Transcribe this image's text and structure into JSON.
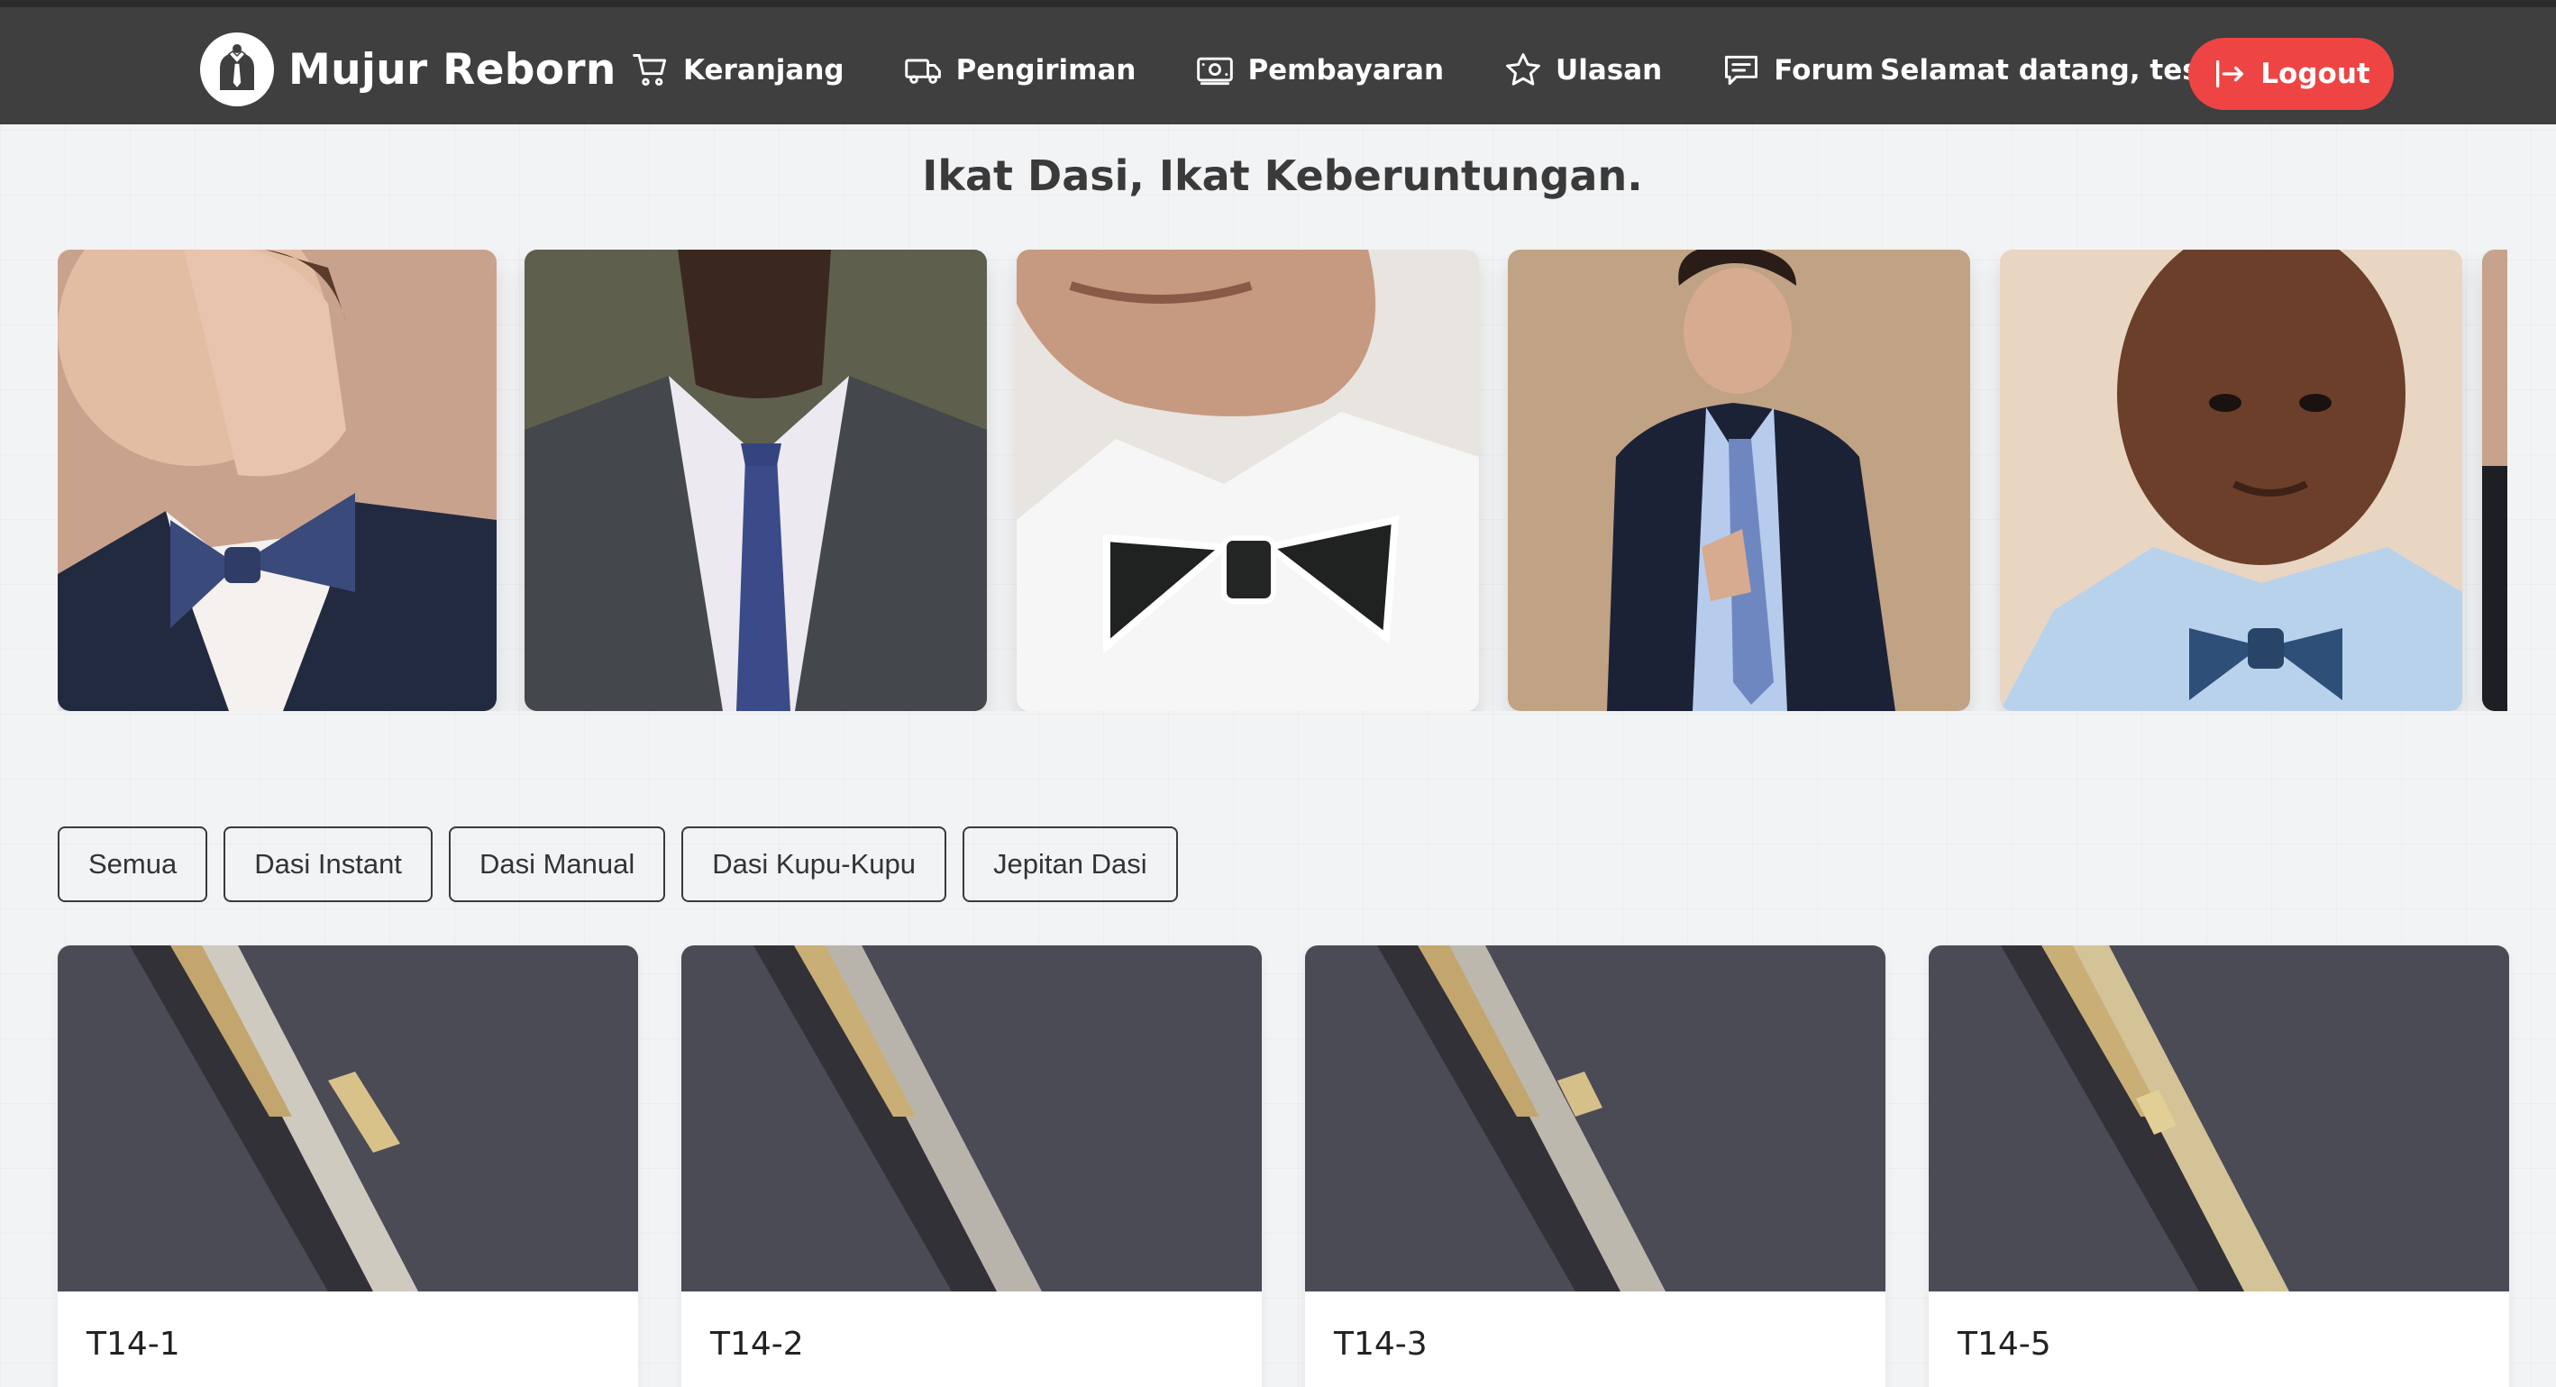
{
  "brand": {
    "name": "Mujur Reborn",
    "logo_icon": "tie-suit-icon"
  },
  "nav": {
    "items": [
      {
        "label": "Keranjang",
        "icon": "cart-icon"
      },
      {
        "label": "Pengiriman",
        "icon": "truck-icon"
      },
      {
        "label": "Pembayaran",
        "icon": "money-icon"
      },
      {
        "label": "Ulasan",
        "icon": "star-icon"
      },
      {
        "label": "Forum",
        "icon": "chat-icon"
      }
    ],
    "greeting": "Selamat datang, test",
    "logout_label": "Logout"
  },
  "hero": {
    "title": "Ikat Dasi, Ikat Keberuntungan.",
    "slides": [
      "man in navy suit with blue bow tie",
      "man in grey suit with blue patterned tie",
      "close-up of black and white bow tie",
      "man in navy suit with light blue tie",
      "man in light blue shirt with blue bow tie"
    ]
  },
  "filters": [
    "Semua",
    "Dasi Instant",
    "Dasi Manual",
    "Dasi Kupu-Kupu",
    "Jepitan Dasi"
  ],
  "products": [
    {
      "name": "T14-1"
    },
    {
      "name": "T14-2"
    },
    {
      "name": "T14-3"
    },
    {
      "name": "T14-5"
    }
  ],
  "colors": {
    "navbar": "#3f3f3f",
    "logout": "#ef4444",
    "background": "#f2f3f5",
    "product_bg": "#4a4b55"
  }
}
